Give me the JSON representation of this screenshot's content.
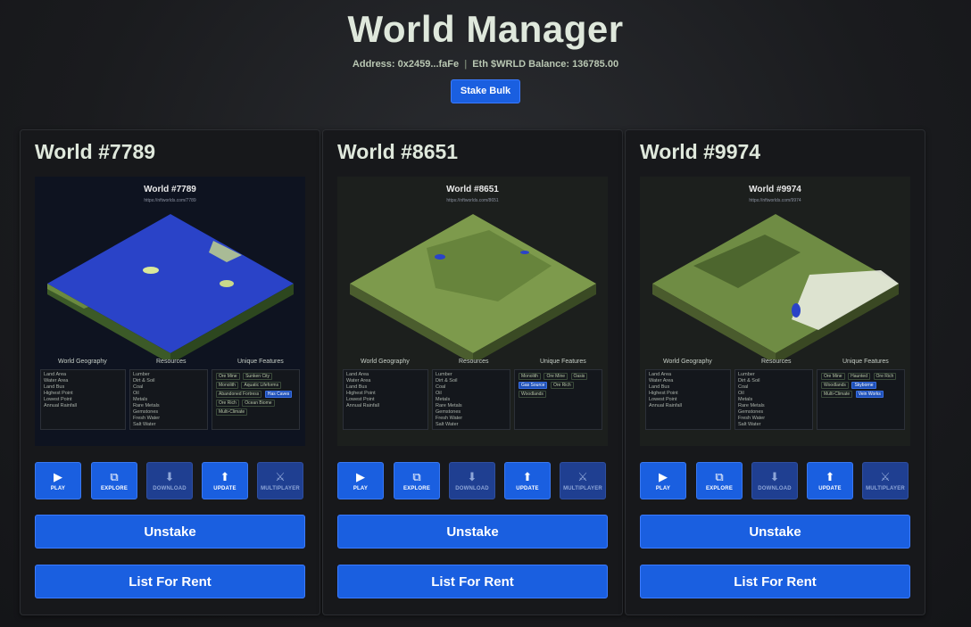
{
  "header": {
    "title": "World Manager",
    "address_label": "Address: 0x2459...faFe",
    "balance_label": "Eth $WRLD Balance: 136785.00",
    "stake_bulk_label": "Stake Bulk"
  },
  "worlds": [
    {
      "title": "World #7789",
      "preview_title": "World #7789",
      "preview_url": "https://nftworlds.com/7789",
      "theme": "ocean",
      "colors": {
        "top": "#2a43c8",
        "left": "#3c5a28",
        "right": "#2f4a22",
        "accent": "#c9d98a"
      },
      "sections": {
        "geography": "World Geography",
        "resources": "Resources",
        "features": "Unique Features"
      },
      "geography": [
        "Land Area",
        "Water Area",
        "Land Bus",
        "Highest Point",
        "Lowest Point",
        "Annual Rainfall"
      ],
      "resources": [
        "Lumber",
        "Dirt & Soil",
        "Coal",
        "Oil",
        "Metals",
        "Rare Metals",
        "Gemstones",
        "Fresh Water",
        "Salt Water"
      ],
      "features": [
        "Ore Mine",
        "Sunken City",
        "Monolith",
        "Aquatic Lifeforms",
        "Abandoned Fortress",
        "Has Caves",
        "Ore Rich",
        "Ocean Biome",
        "Multi-Climate"
      ],
      "highlighted_features": [
        "Has Caves"
      ],
      "tools": [
        "PLAY",
        "EXPLORE",
        "DOWNLOAD",
        "UPDATE",
        "MULTIPLAYER"
      ],
      "unstake_label": "Unstake",
      "rent_label": "List For Rent"
    },
    {
      "title": "World #8651",
      "preview_title": "World #8651",
      "preview_url": "https://nftworlds.com/8651",
      "theme": "grass",
      "colors": {
        "top": "#7d9a4c",
        "left": "#4b5d2e",
        "right": "#3a4a24",
        "accent": "#a9c46a"
      },
      "sections": {
        "geography": "World Geography",
        "resources": "Resources",
        "features": "Unique Features"
      },
      "geography": [
        "Land Area",
        "Water Area",
        "Land Bus",
        "Highest Point",
        "Lowest Point",
        "Annual Rainfall"
      ],
      "resources": [
        "Lumber",
        "Dirt & Soil",
        "Coal",
        "Oil",
        "Metals",
        "Rare Metals",
        "Gemstones",
        "Fresh Water",
        "Salt Water"
      ],
      "features": [
        "Monolith",
        "Ore Mine",
        "Oasis",
        "Gas Source",
        "Ore Rich",
        "Woodlands"
      ],
      "highlighted_features": [
        "Gas Source"
      ],
      "tools": [
        "PLAY",
        "EXPLORE",
        "DOWNLOAD",
        "UPDATE",
        "MULTIPLAYER"
      ],
      "unstake_label": "Unstake",
      "rent_label": "List For Rent"
    },
    {
      "title": "World #9974",
      "preview_title": "World #9974",
      "preview_url": "https://nftworlds.com/9974",
      "theme": "snow",
      "colors": {
        "top": "#6f8c44",
        "left": "#4a5b2d",
        "right": "#3a4823",
        "accent": "#e9ece0"
      },
      "sections": {
        "geography": "World Geography",
        "resources": "Resources",
        "features": "Unique Features"
      },
      "geography": [
        "Land Area",
        "Water Area",
        "Land Bus",
        "Highest Point",
        "Lowest Point",
        "Annual Rainfall"
      ],
      "resources": [
        "Lumber",
        "Dirt & Soil",
        "Coal",
        "Oil",
        "Metals",
        "Rare Metals",
        "Gemstones",
        "Fresh Water",
        "Salt Water"
      ],
      "features": [
        "Ore Mine",
        "Haunted",
        "Ore Rich",
        "Woodlands",
        "Skyborne",
        "Multi-Climate",
        "Vein Works"
      ],
      "highlighted_features": [
        "Skyborne",
        "Vein Works"
      ],
      "tools": [
        "PLAY",
        "EXPLORE",
        "DOWNLOAD",
        "UPDATE",
        "MULTIPLAYER"
      ],
      "unstake_label": "Unstake",
      "rent_label": "List For Rent"
    }
  ]
}
